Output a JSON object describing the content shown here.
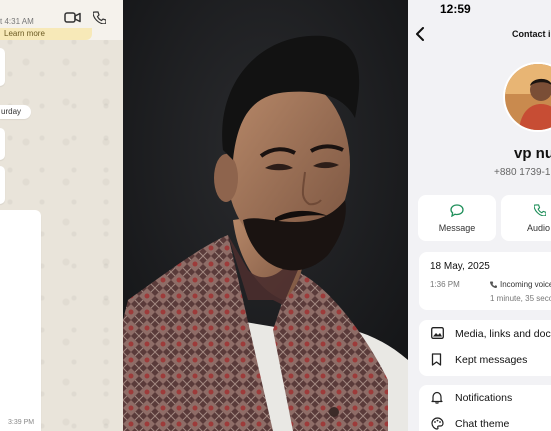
{
  "chat": {
    "last_seen": "t 4:31 AM",
    "learn_more": "Learn more",
    "day_label": "urday",
    "bubble_time": "3:39 PM"
  },
  "contact": {
    "status_time": "12:59",
    "title": "Contact i",
    "name": "vp nu",
    "phone": "+880 1739-1",
    "actions": [
      {
        "label": "Message",
        "icon": "message-icon"
      },
      {
        "label": "Audio",
        "icon": "phone-icon"
      }
    ],
    "call": {
      "date": "18 May, 2025",
      "time": "1:36 PM",
      "type": "Incoming voice c",
      "duration": "1 minute, 35 secon"
    },
    "rows_a": [
      {
        "label": "Media, links and doc",
        "icon": "media-icon"
      },
      {
        "label": "Kept messages",
        "icon": "bookmark-icon"
      }
    ],
    "rows_b": [
      {
        "label": "Notifications",
        "icon": "bell-icon"
      },
      {
        "label": "Chat theme",
        "icon": "palette-icon"
      }
    ]
  },
  "colors": {
    "chat_bg": "#e9e4da",
    "accent": "#25a366",
    "panel_bg": "#f2f2f5"
  }
}
